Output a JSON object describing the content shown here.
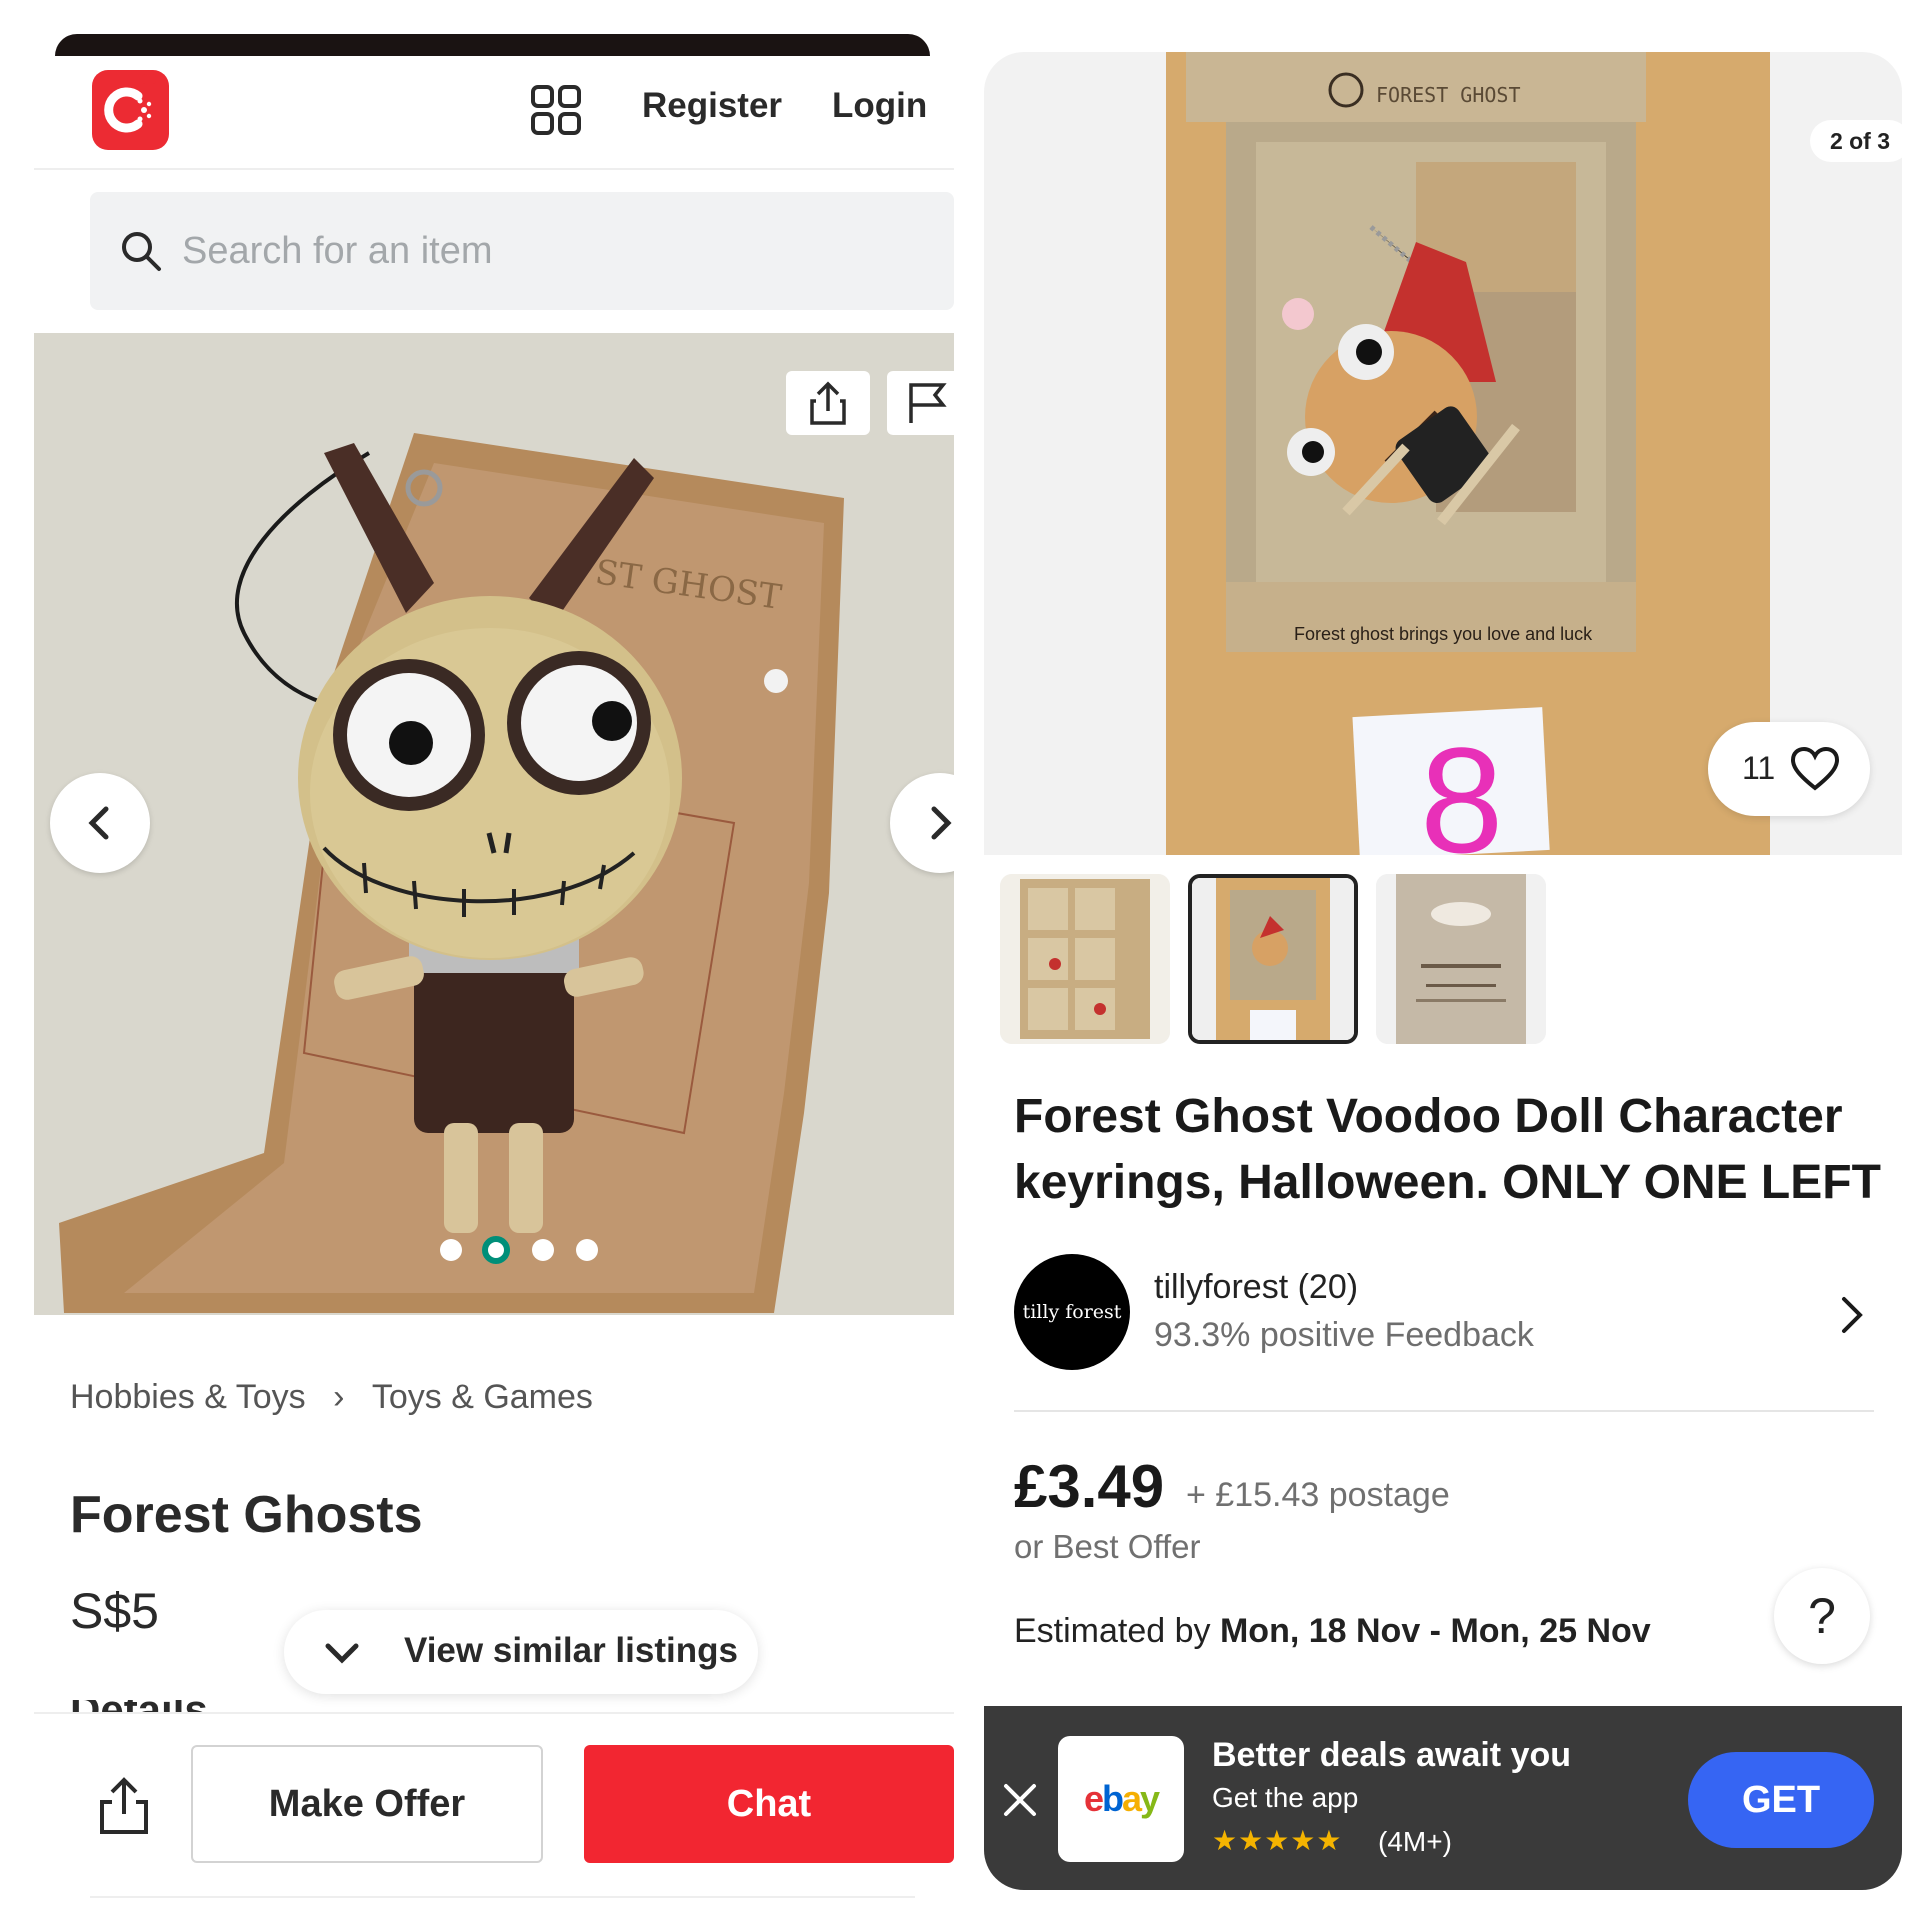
{
  "carousell": {
    "header": {
      "register_label": "Register",
      "login_label": "Login"
    },
    "search": {
      "placeholder": "Search for an item"
    },
    "photo": {
      "dot_count": 4,
      "active_dot": 2
    },
    "breadcrumb": {
      "level1": "Hobbies & Toys",
      "separator": "›",
      "level2": "Toys & Games"
    },
    "listing": {
      "title": "Forest Ghosts",
      "price": "S$5"
    },
    "similar_label": "View similar listings",
    "details_peek": "Details",
    "actions": {
      "offer_label": "Make Offer",
      "chat_label": "Chat"
    },
    "colors": {
      "brand_red": "#f22631",
      "carousel_active": "#008f79"
    }
  },
  "ebay": {
    "photo": {
      "counter": "2 of 3",
      "box_brand": "FOREST GHOST",
      "box_tagline": "Forest ghost brings you love and luck",
      "sticker_number": "8",
      "watch_count": "11"
    },
    "thumbnail_count": 3,
    "selected_thumbnail": 2,
    "title": "Forest Ghost Voodoo Doll Character keyrings, Halloween. ONLY ONE LEFT",
    "seller": {
      "avatar_text": "tilly forest",
      "name": "tillyforest (20)",
      "feedback": "93.3% positive Feedback"
    },
    "price": "£3.49",
    "postage": "+ £15.43 postage",
    "best_offer": "or Best Offer",
    "delivery": {
      "prefix": "Estimated by",
      "dates": "Mon, 18 Nov - Mon, 25 Nov"
    },
    "help_label": "?",
    "app_banner": {
      "logo_text": "ebay",
      "title": "Better deals await you",
      "subtitle": "Get the app",
      "stars": "★★★★★",
      "rating": "(4M+)",
      "get_label": "GET"
    },
    "colors": {
      "get_button": "#3665f3",
      "sticker_digit": "#e830b8",
      "star": "#f5b400"
    }
  }
}
